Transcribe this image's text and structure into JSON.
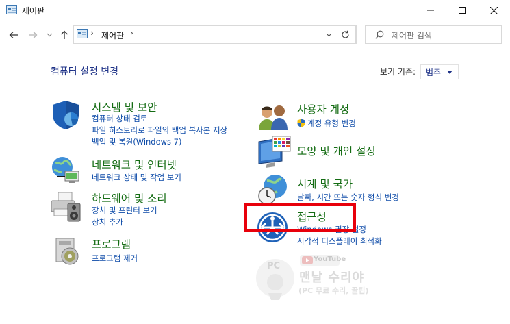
{
  "window": {
    "title": "제어판",
    "minimize_icon": "minimize-icon",
    "maximize_icon": "maximize-icon",
    "close_icon": "close-icon"
  },
  "nav": {
    "back_icon": "arrow-left-icon",
    "forward_icon": "arrow-right-icon",
    "recent_icon": "chevron-down-icon",
    "up_icon": "arrow-up-icon"
  },
  "address": {
    "separator": "›",
    "crumb": "제어판",
    "refresh_icon": "refresh-icon"
  },
  "search": {
    "placeholder": "제어판 검색"
  },
  "header": {
    "title": "컴퓨터 설정 변경",
    "view_by_label": "보기 기준:",
    "view_by_value": "범주"
  },
  "categories_left": [
    {
      "title": "시스템 및 보안",
      "icon": "system-security-shield-icon",
      "links": [
        "컴퓨터 상태 검토",
        "파일 히스토리로 파일의 백업 복사본 저장",
        "백업 및 복원(Windows 7)"
      ]
    },
    {
      "title": "네트워크 및 인터넷",
      "icon": "network-globe-icon",
      "links": [
        "네트워크 상태 및 작업 보기"
      ]
    },
    {
      "title": "하드웨어 및 소리",
      "icon": "printer-speaker-icon",
      "links": [
        "장치 및 프린터 보기",
        "장치 추가"
      ]
    },
    {
      "title": "프로그램",
      "icon": "programs-disc-icon",
      "links": [
        "프로그램 제거"
      ]
    }
  ],
  "categories_right": [
    {
      "title": "사용자 계정",
      "icon": "user-accounts-icon",
      "links": [
        "계정 유형 변경"
      ]
    },
    {
      "title": "모양 및 개인 설정",
      "icon": "appearance-monitor-icon",
      "links": []
    },
    {
      "title": "시계 및 국가",
      "icon": "clock-globe-icon",
      "links": [
        "날짜, 시간 또는 숫자 형식 변경"
      ]
    },
    {
      "title": "접근성",
      "icon": "ease-of-access-icon",
      "links": [
        "Windows 권장 설정",
        "시각적 디스플레이 최적화"
      ]
    }
  ],
  "watermark": {
    "badge": "YouTube",
    "logo_text": "PC",
    "title": "맨날 수리야",
    "subtitle": "(PC 무료 수리, 꿀팁)"
  },
  "colors": {
    "category_title": "#146c13",
    "link": "#0d4ba8",
    "heading": "#1e3287",
    "highlight_box": "#e8000b"
  }
}
